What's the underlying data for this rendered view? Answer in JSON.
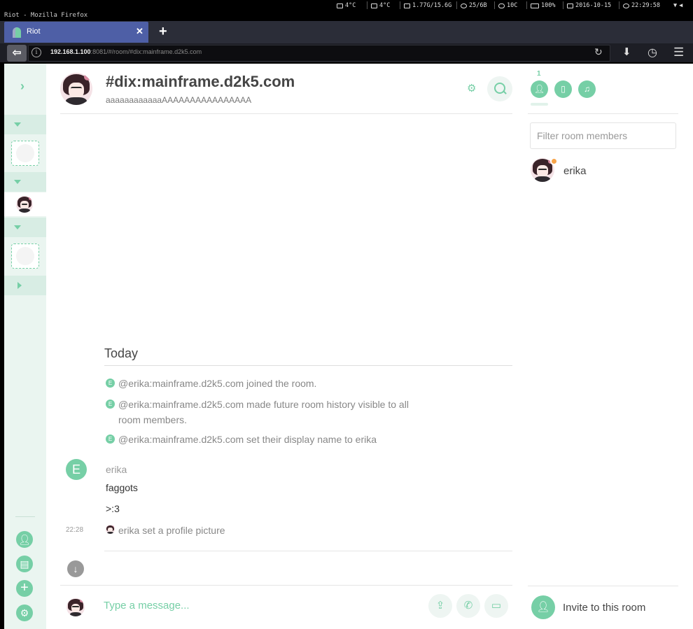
{
  "system_bar": {
    "items": [
      "4°C",
      "4°C",
      "1.77G/15.6G",
      "25/6B",
      "10C",
      "100%",
      "2016-10-15",
      "22:29:58"
    ]
  },
  "window_title": "Riot - Mozilla Firefox",
  "browser": {
    "tab_title": "Riot",
    "tab_close": "✕",
    "new_tab": "+",
    "url_host": "192.168.1.100",
    "url_rest": ":8081/#/room/#dix:mainframe.d2k5.com"
  },
  "room": {
    "name": "#dix:mainframe.d2k5.com",
    "topic": "aaaaaaaaaaaaAAAAAAAAAAAAAAAA"
  },
  "timeline": {
    "date_separator": "Today",
    "events": [
      {
        "text": "@erika:mainframe.d2k5.com joined the room."
      },
      {
        "text": "@erika:mainframe.d2k5.com made future room history visible to all",
        "text2": "room members."
      },
      {
        "text": "@erika:mainframe.d2k5.com set their display name to erika"
      }
    ],
    "sender_initial": "E",
    "event_initial": "E",
    "sender": "erika",
    "messages": [
      "faggots",
      ">:3"
    ],
    "timestamp": "22:28",
    "profile_event": "erika set a profile picture"
  },
  "composer": {
    "placeholder": "Type a message..."
  },
  "right_panel": {
    "member_count": "1",
    "filter_placeholder": "Filter room members",
    "members": [
      {
        "name": "erika"
      }
    ],
    "invite_label": "Invite to this room"
  },
  "colors": {
    "accent": "#76cfa6",
    "browser_tab": "#4e5fa6"
  }
}
